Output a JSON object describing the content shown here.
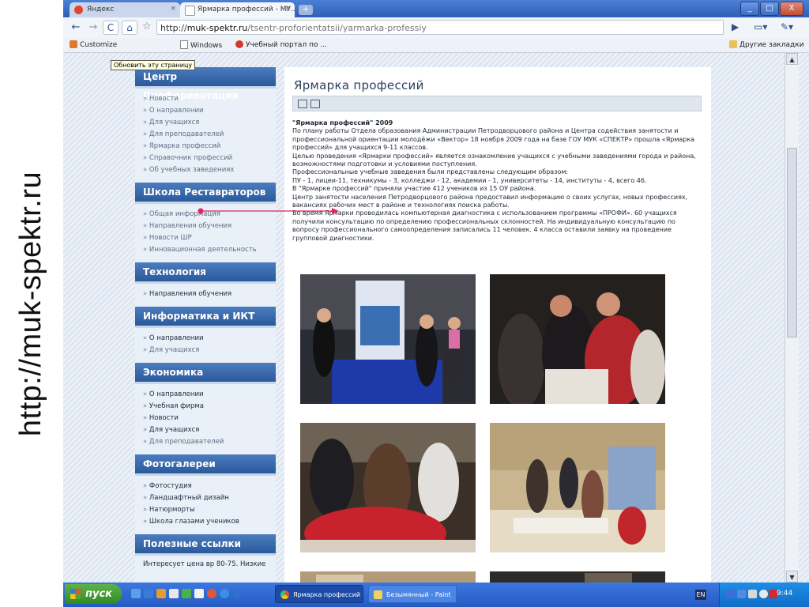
{
  "slide": {
    "url_label": "http://muk-spektr.ru"
  },
  "browser": {
    "tabs": [
      {
        "label": "Яндекс",
        "close": "×"
      },
      {
        "label": "Ярмарка профессий - МУ...",
        "close": "×"
      }
    ],
    "new_tab": "+",
    "window_buttons": {
      "minimize": "_",
      "maximize": "□",
      "close": "X"
    },
    "address": {
      "scheme": "http://",
      "host": "muk-spektr.ru",
      "path": "/tsentr-proforientatsii/yarmarka-professiy"
    },
    "bookmarks": [
      {
        "label": "Customize"
      },
      {
        "label": "Windows"
      },
      {
        "label": "Учебный портал по ..."
      }
    ],
    "bookmarks_other": "Другие закладки",
    "tooltip": "Обновить эту страницу"
  },
  "sidebar": {
    "sections": [
      {
        "title": "Центр Профориентации",
        "items": [
          {
            "label": "Новости",
            "dark": false
          },
          {
            "label": "О направлении",
            "dark": false
          },
          {
            "label": "Для учащихся",
            "dark": false
          },
          {
            "label": "Для преподавателей",
            "dark": false
          },
          {
            "label": "Ярмарка профессий",
            "dark": false
          },
          {
            "label": "Справочник профессий",
            "dark": false
          },
          {
            "label": "Об учебных заведениях",
            "dark": false
          }
        ]
      },
      {
        "title": "Школа Реставраторов",
        "items": [
          {
            "label": "Общая информация",
            "dark": false
          },
          {
            "label": "Направления обучения",
            "dark": false
          },
          {
            "label": "Новости ШР",
            "dark": false
          },
          {
            "label": "Инновационная деятельность",
            "dark": false
          }
        ]
      },
      {
        "title": "Технология",
        "items": [
          {
            "label": "Направления обучения",
            "dark": true
          }
        ]
      },
      {
        "title": "Информатика и ИКТ",
        "items": [
          {
            "label": "О направлении",
            "dark": true
          },
          {
            "label": "Для учащихся",
            "dark": false
          }
        ]
      },
      {
        "title": "Экономика",
        "items": [
          {
            "label": "О направлении",
            "dark": true
          },
          {
            "label": "Учебная фирма",
            "dark": true
          },
          {
            "label": "Новости",
            "dark": true
          },
          {
            "label": "Для учащихся",
            "dark": true
          },
          {
            "label": "Для преподавателей",
            "dark": false
          }
        ]
      },
      {
        "title": "Фотогалереи",
        "items": [
          {
            "label": "Фотостудия",
            "dark": true
          },
          {
            "label": "Ландшафтный дизайн",
            "dark": true
          },
          {
            "label": "Натюрморты",
            "dark": true
          },
          {
            "label": "Школа глазами учеников",
            "dark": true
          }
        ]
      },
      {
        "title": "Полезные ссылки",
        "text": "Интересует цена вр 80-75. Низкие"
      }
    ]
  },
  "content": {
    "title": "Ярмарка профессий",
    "article_heading": "\"Ярмарка профессий\" 2009",
    "paragraphs": [
      "По плану работы Отдела образования Администрации Петродворцового района и Центра содействия занятости и профессиональной ориентации молодёжи «Вектор» 18 ноября 2009 года на базе ГОУ МУК «СПЕКТР» прошла «Ярмарка профессий» для учащихся 9-11 классов.",
      "Целью проведения «Ярмарки профессий» является ознакомление учащихся с учебными заведениями города и района, возможностями подготовки и условиями поступления.",
      "Профессиональные учебные заведения были представлены следующим образом:",
      "ПУ - 1, лицеи-11, техникумы - 3, колледжи - 12, академии - 1, университеты - 14, институты - 4, всего 46.",
      "В \"Ярмарке профессий\" приняли участие 412 учеников из 15 ОУ района.",
      "Центр занятости населения Петродворцового района предоставил информацию о своих услугах, новых профессиях, вакансиях рабочих мест в районе и технологиях поиска работы.",
      "Во время Ярмарки проводилась компьютерная диагностика с использованием программы «ПРОФИ». 60 учащихся получили консультацию по определению профессиональных склонностей. На индивидуальную консультацию по вопросу профессионального самоопределения записались 11 человек. 4 класса оставили заявку на проведение групповой диагностики."
    ]
  },
  "taskbar": {
    "start_label": "пуск",
    "tasks": [
      {
        "label": "Ярмарка профессий ..."
      },
      {
        "label": "Безымянный - Paint"
      }
    ],
    "lang": "EN",
    "clock": "9:44"
  },
  "colors": {
    "accent": "#2a5a9c",
    "pointer": "#e0245e"
  }
}
